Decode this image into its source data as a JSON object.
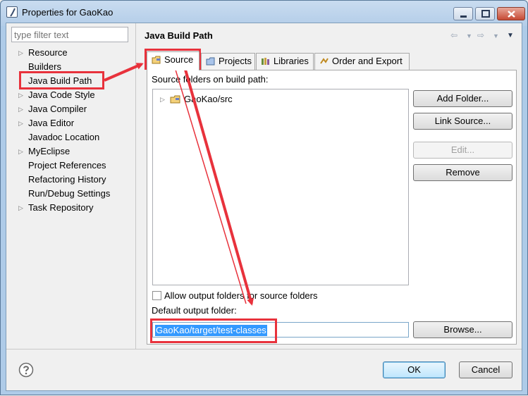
{
  "window": {
    "title": "Properties for GaoKao"
  },
  "left_pane": {
    "filter_placeholder": "type filter text",
    "items": [
      {
        "label": "Resource",
        "expandable": true
      },
      {
        "label": "Builders",
        "expandable": false
      },
      {
        "label": "Java Build Path",
        "expandable": false,
        "selected": true
      },
      {
        "label": "Java Code Style",
        "expandable": true
      },
      {
        "label": "Java Compiler",
        "expandable": true
      },
      {
        "label": "Java Editor",
        "expandable": true
      },
      {
        "label": "Javadoc Location",
        "expandable": false
      },
      {
        "label": "MyEclipse",
        "expandable": true
      },
      {
        "label": "Project References",
        "expandable": false
      },
      {
        "label": "Refactoring History",
        "expandable": false
      },
      {
        "label": "Run/Debug Settings",
        "expandable": false
      },
      {
        "label": "Task Repository",
        "expandable": true
      }
    ]
  },
  "page": {
    "title": "Java Build Path",
    "tabs": [
      {
        "label": "Source",
        "active": true
      },
      {
        "label": "Projects",
        "active": false
      },
      {
        "label": "Libraries",
        "active": false
      },
      {
        "label": "Order and Export",
        "active": false
      }
    ],
    "source_folders_label": "Source folders on build path:",
    "source_folders": [
      "GaoKao/src"
    ],
    "buttons": {
      "add_folder": "Add Folder...",
      "link_source": "Link Source...",
      "edit": "Edit...",
      "remove": "Remove",
      "browse": "Browse..."
    },
    "allow_output_label": "Allow output folders for source folders",
    "allow_output_checked": false,
    "default_output_label": "Default output folder:",
    "default_output_value": "GaoKao/target/test-classes"
  },
  "footer": {
    "ok": "OK",
    "cancel": "Cancel"
  },
  "colors": {
    "annotation": "#e8323c",
    "selection": "#3399ff"
  }
}
